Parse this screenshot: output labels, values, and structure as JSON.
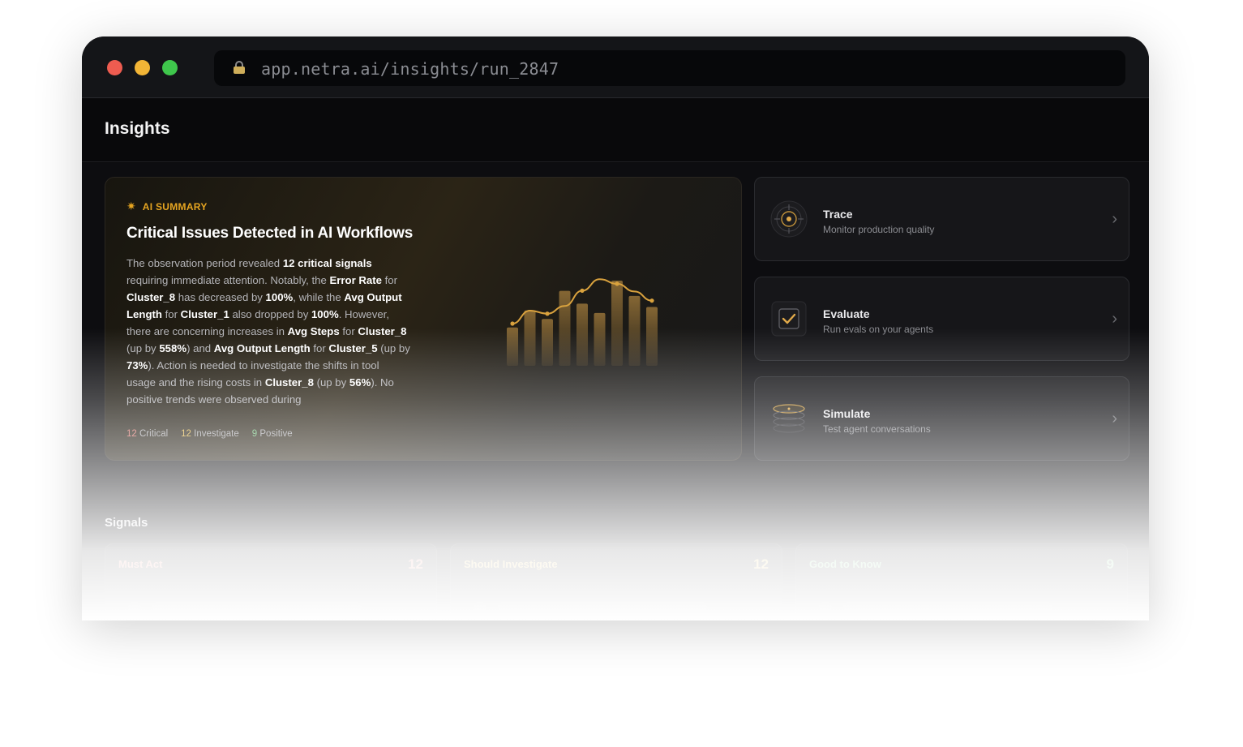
{
  "browser": {
    "url": "app.netra.ai/insights/run_2847"
  },
  "header": {
    "title": "Insights"
  },
  "summary": {
    "tag": "AI SUMMARY",
    "title": "Critical Issues Detected in AI Workflows",
    "body": [
      {
        "t": "The observation period revealed "
      },
      {
        "b": "12 critical signals"
      },
      {
        "t": " requiring immediate attention. Notably, the "
      },
      {
        "b": "Error Rate"
      },
      {
        "t": " for "
      },
      {
        "b": "Cluster_8"
      },
      {
        "t": " has decreased by "
      },
      {
        "b": "100%"
      },
      {
        "t": ", while the "
      },
      {
        "b": "Avg Output Length"
      },
      {
        "t": " for "
      },
      {
        "b": "Cluster_1"
      },
      {
        "t": " also dropped by "
      },
      {
        "b": "100%"
      },
      {
        "t": ". However, there are concerning increases in "
      },
      {
        "b": "Avg Steps"
      },
      {
        "t": " for "
      },
      {
        "b": "Cluster_8"
      },
      {
        "t": " (up by "
      },
      {
        "b": "558%"
      },
      {
        "t": ") and "
      },
      {
        "b": "Avg Output Length"
      },
      {
        "t": " for "
      },
      {
        "b": "Cluster_5"
      },
      {
        "t": " (up by "
      },
      {
        "b": "73%"
      },
      {
        "t": "). Action is needed to investigate the shifts in tool usage and the rising costs in "
      },
      {
        "b": "Cluster_8"
      },
      {
        "t": " (up by "
      },
      {
        "b": "56%"
      },
      {
        "t": "). No positive trends were observed during"
      }
    ],
    "counts": {
      "critical_n": "12",
      "critical_label": "Critical",
      "investigate_n": "12",
      "investigate_label": "Investigate",
      "positive_n": "9",
      "positive_label": "Positive"
    }
  },
  "chart_data": {
    "type": "bar",
    "bars": [
      0.45,
      0.65,
      0.55,
      0.88,
      0.73,
      0.62,
      1.0,
      0.82,
      0.69
    ],
    "line": [
      0.55,
      0.72,
      0.68,
      0.78,
      0.98,
      1.13,
      1.07,
      0.97,
      0.85
    ],
    "colors": {
      "bar": "#8a6a35",
      "line": "#d9a23e"
    }
  },
  "actions": [
    {
      "name": "Trace",
      "desc": "Monitor production quality",
      "icon": "target-icon"
    },
    {
      "name": "Evaluate",
      "desc": "Run evals on your agents",
      "icon": "checkbox-icon"
    },
    {
      "name": "Simulate",
      "desc": "Test agent conversations",
      "icon": "layers-icon"
    }
  ],
  "signals": {
    "title": "Signals",
    "cards": [
      {
        "name": "Must Act",
        "count": "12",
        "color": "#e8837a"
      },
      {
        "name": "Should Investigate",
        "count": "12",
        "color": "#e6bf5a"
      },
      {
        "name": "Good to Know",
        "count": "9",
        "color": "#7ccc8a"
      }
    ]
  }
}
